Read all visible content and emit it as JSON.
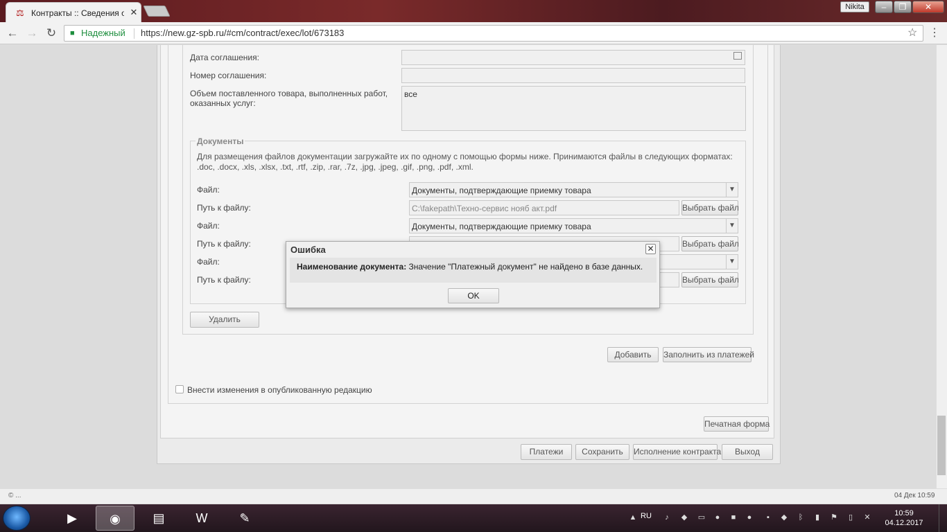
{
  "browser": {
    "tab_title": "Контракты :: Сведения о",
    "tab_close": "✕",
    "profile": "Nikita",
    "secure_label": "Надежный",
    "url": "https://new.gz-spb.ru/#cm/contract/exec/lot/673183"
  },
  "form": {
    "agreement_date_label": "Дата соглашения:",
    "agreement_number_label": "Номер соглашения:",
    "volume_label_line1": "Объем поставленного товара, выполненных работ,",
    "volume_label_line2": "оказанных услуг:",
    "volume_value": "все",
    "documents_legend": "Документы",
    "documents_hint": "Для размещения файлов документации загружайте их по одному с помощью формы ниже. Принимаются файлы в следующих форматах: .doc, .docx, .xls, .xlsx, .txt, .rtf, .zip, .rar, .7z, .jpg, .jpeg, .gif, .png, .pdf, .xml.",
    "file_rows": [
      {
        "file_label": "Файл:",
        "file_value": "Документы, подтверждающие приемку товара",
        "path_label": "Путь к файлу:",
        "path_value": "C:\\fakepath\\Техно-сервис нояб акт.pdf",
        "browse_label": "Выбрать файл"
      },
      {
        "file_label": "Файл:",
        "file_value": "Документы, подтверждающие приемку товара",
        "path_label": "Путь к файлу:",
        "path_value": "",
        "browse_label": "Выбрать файл"
      },
      {
        "file_label": "Файл:",
        "file_value": "",
        "path_label": "Путь к файлу:",
        "path_value": "",
        "browse_label": "Выбрать файл"
      }
    ],
    "delete_button": "Удалить",
    "add_button": "Добавить",
    "fill_from_payments_button": "Заполнить из платежей",
    "publish_changes_label": "Внести изменения в опубликованную редакцию",
    "print_form_button": "Печатная форма",
    "payments_button": "Платежи",
    "save_button": "Сохранить",
    "contract_execution_button": "Исполнение контракта",
    "exit_button": "Выход"
  },
  "dialog": {
    "title": "Ошибка",
    "close": "✕",
    "message_bold": "Наименование документа:",
    "message_text": " Значение \"Платежный документ\" не найдено в базе данных.",
    "ok_button": "OK"
  },
  "statusbar": {
    "left_text": "© ...",
    "right_text": "04 Дек 10:59"
  },
  "taskbar": {
    "lang": "RU",
    "time": "10:59",
    "date": "04.12.2017",
    "apps": [
      "media-player",
      "chrome",
      "file-explorer",
      "word",
      "paint"
    ]
  }
}
